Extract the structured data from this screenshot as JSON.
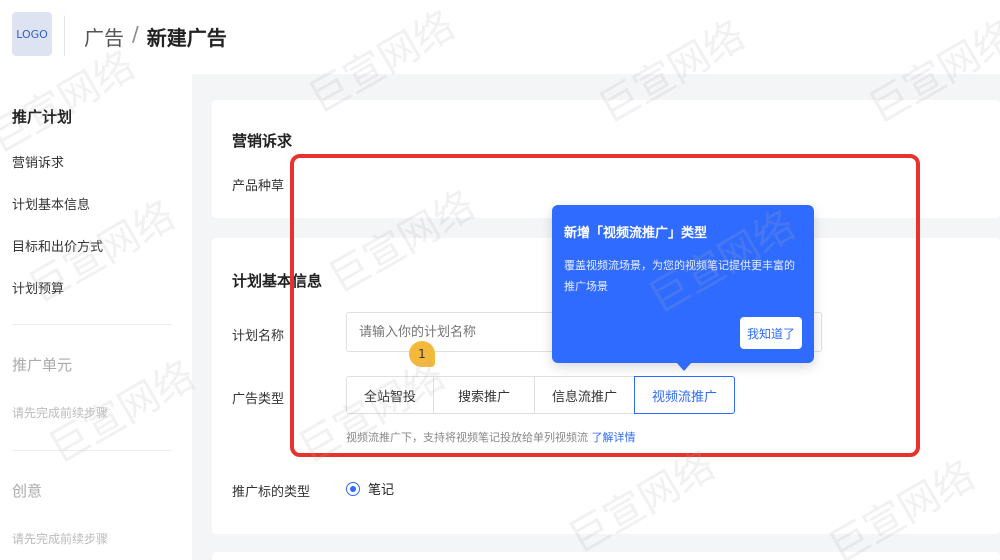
{
  "header": {
    "logo_text": "LOGO",
    "breadcrumb_parent": "广告",
    "breadcrumb_separator": "/",
    "breadcrumb_current": "新建广告"
  },
  "sidebar": {
    "group_title": "推广计划",
    "items": [
      "营销诉求",
      "计划基本信息",
      "目标和出价方式",
      "计划预算"
    ],
    "unit_title": "推广单元",
    "unit_hint": "请先完成前续步骤",
    "creative_title": "创意",
    "creative_hint": "请先完成前续步骤"
  },
  "marketing": {
    "title": "营销诉求",
    "product_label": "产品种草"
  },
  "basic_info": {
    "title": "计划基本信息",
    "name_label": "计划名称",
    "name_placeholder": "请输入你的计划名称",
    "ad_type_label": "广告类型",
    "ad_types": [
      "全站智投",
      "搜索推广",
      "信息流推广",
      "视频流推广"
    ],
    "ad_type_selected": "视频流推广",
    "hint_text": "视频流推广下，支持将视频笔记投放给单列视频流",
    "hint_link": "了解详情",
    "target_type_label": "推广标的类型",
    "target_type_option": "笔记"
  },
  "guide": {
    "step_number": "1",
    "title": "新增「视频流推广」类型",
    "body": "覆盖视频流场景，为您的视频笔记提供更丰富的推广场景",
    "button": "我知道了"
  },
  "watermark_text": "巨宣网络",
  "colors": {
    "primary": "#2f6bff",
    "highlight_red": "#e8322d",
    "badge_yellow": "#f4b83a"
  }
}
